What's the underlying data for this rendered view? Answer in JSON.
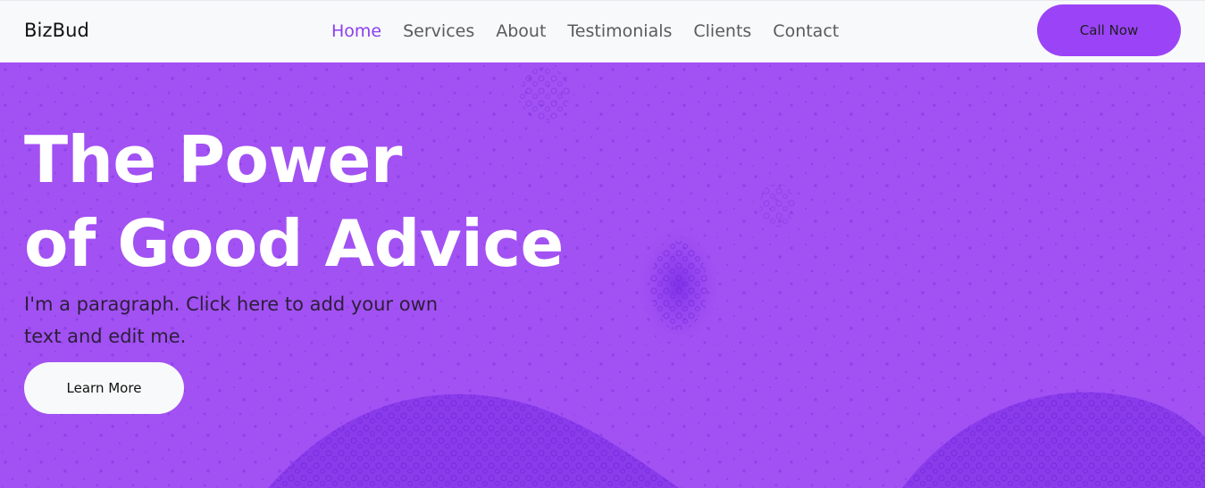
{
  "nav": {
    "brand": "BizBud",
    "links": [
      {
        "label": "Home",
        "active": true
      },
      {
        "label": "Services",
        "active": false
      },
      {
        "label": "About",
        "active": false
      },
      {
        "label": "Testimonials",
        "active": false
      },
      {
        "label": "Clients",
        "active": false
      },
      {
        "label": "Contact",
        "active": false
      }
    ],
    "cta_label": "Call Now"
  },
  "hero": {
    "title_line1": "The Power",
    "title_line2": "of Good Advice",
    "paragraph": "I'm a paragraph. Click here to add your own text and edit me.",
    "button_label": "Learn More"
  },
  "colors": {
    "accent": "#8b3ff0",
    "cta_bg": "#9b44f7",
    "hero_bg": "#a251f3",
    "nav_bg": "#f8f9fa"
  }
}
